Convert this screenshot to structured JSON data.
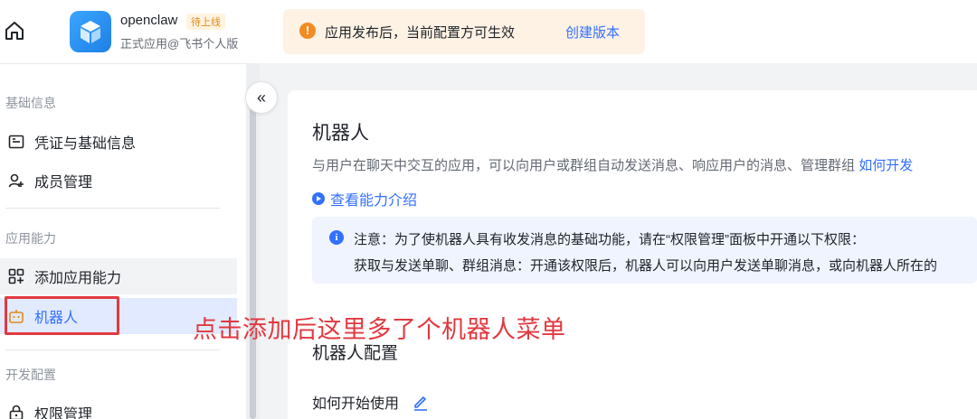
{
  "topbar": {
    "app_name": "openclaw",
    "app_badge": "待上线",
    "app_subtitle": "正式应用@飞书个人版",
    "notice_text": "应用发布后，当前配置方可生效",
    "notice_link": "创建版本"
  },
  "sidebar": {
    "section_basic": "基础信息",
    "item_credentials": "凭证与基础信息",
    "item_members": "成员管理",
    "section_capability": "应用能力",
    "item_add_capability": "添加应用能力",
    "item_bot": "机器人",
    "section_dev": "开发配置",
    "item_permissions": "权限管理"
  },
  "main": {
    "title": "机器人",
    "description": "与用户在聊天中交互的应用，可以向用户或群组自动发送消息、响应用户的消息、管理群组",
    "description_link": "如何开发",
    "intro_link": "查看能力介绍",
    "info_line1": "注意：为了使机器人具有收发消息的基础功能，请在“权限管理”面板中开通以下权限：",
    "info_line2": "获取与发送单聊、群组消息：开通该权限后，机器人可以向用户发送单聊消息，或向机器人所在的",
    "bot_config": "机器人配置",
    "how_start": "如何开始使用"
  },
  "annotation": "点击添加后这里多了个机器人菜单",
  "colors": {
    "accent": "#3370ff",
    "annotation_red": "#e2393f",
    "notice_bg": "#fdf2e4",
    "notice_icon": "#f38b23",
    "active_bg": "#e1eaff"
  }
}
